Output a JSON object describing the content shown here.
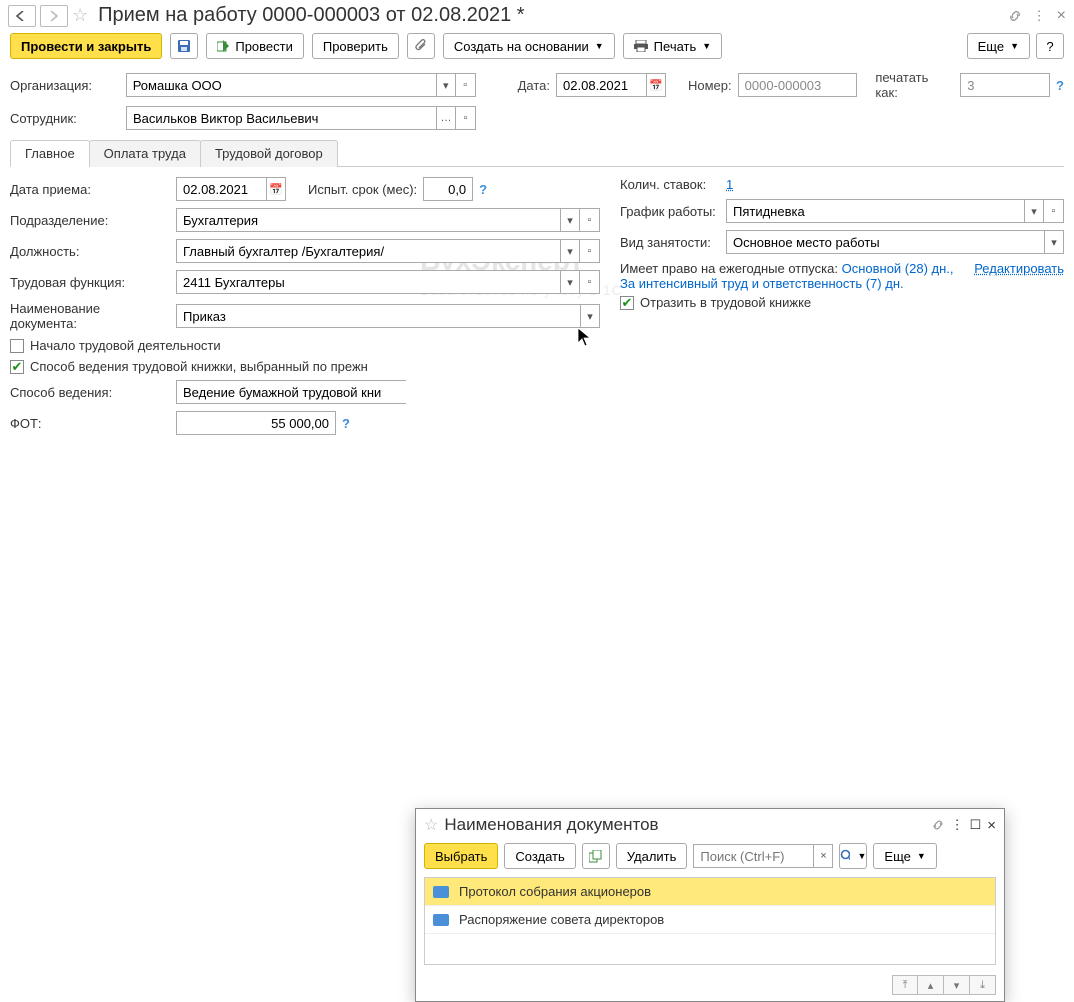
{
  "window": {
    "title": "Прием на работу 0000-000003 от 02.08.2021 *"
  },
  "toolbar": {
    "post_close": "Провести и закрыть",
    "post": "Провести",
    "check": "Проверить",
    "create_based": "Создать на основании",
    "print": "Печать",
    "more": "Еще",
    "help": "?"
  },
  "header": {
    "org_label": "Организация:",
    "org_value": "Ромашка ООО",
    "date_label": "Дата:",
    "date_value": "02.08.2021",
    "number_label": "Номер:",
    "number_value": "0000-000003",
    "print_as_label": "печатать как:",
    "print_as_value": "3",
    "employee_label": "Сотрудник:",
    "employee_value": "Васильков Виктор Васильевич"
  },
  "tabs": {
    "main": "Главное",
    "pay": "Оплата труда",
    "contract": "Трудовой договор"
  },
  "left": {
    "hire_date_label": "Дата приема:",
    "hire_date_value": "02.08.2021",
    "probation_label": "Испыт. срок (мес):",
    "probation_value": "0,0",
    "dept_label": "Подразделение:",
    "dept_value": "Бухгалтерия",
    "position_label": "Должность:",
    "position_value": "Главный бухгалтер /Бухгалтерия/",
    "func_label": "Трудовая функция:",
    "func_value": "2411 Бухгалтеры",
    "docname_label": "Наименование документа:",
    "docname_value": "Приказ",
    "chk_start": "Начало трудовой деятельности",
    "chk_method": "Способ ведения трудовой книжки, выбранный по прежнему месту работы",
    "chk_method_short": "Способ ведения трудовой книжки, выбранный по прежн",
    "method_label": "Способ ведения:",
    "method_value": "Ведение бумажной трудовой книжки",
    "method_value_short": "Ведение бумажной трудовой кни",
    "fot_label": "ФОТ:",
    "fot_value": "55 000,00"
  },
  "right": {
    "rates_label": "Колич. ставок:",
    "rates_value": "1",
    "schedule_label": "График работы:",
    "schedule_value": "Пятидневка",
    "emptype_label": "Вид занятости:",
    "emptype_value": "Основное место работы",
    "leave_text": "Имеет право на ежегодные отпуска:",
    "leave_main": "Основной (28) дн.,",
    "leave_extra": "За интенсивный труд и ответственность (7) дн.",
    "edit_link": "Редактировать",
    "reflect_chk": "Отразить в трудовой книжке"
  },
  "popup": {
    "title": "Наименования документов",
    "select": "Выбрать",
    "create": "Создать",
    "delete": "Удалить",
    "search_ph": "Поиск (Ctrl+F)",
    "more": "Еще",
    "items": [
      "Протокол собрания акционеров",
      "Распоряжение совета директоров"
    ]
  },
  "watermark": {
    "big": "БухЭксперт",
    "small": "База ответов по учёту в 1С"
  }
}
